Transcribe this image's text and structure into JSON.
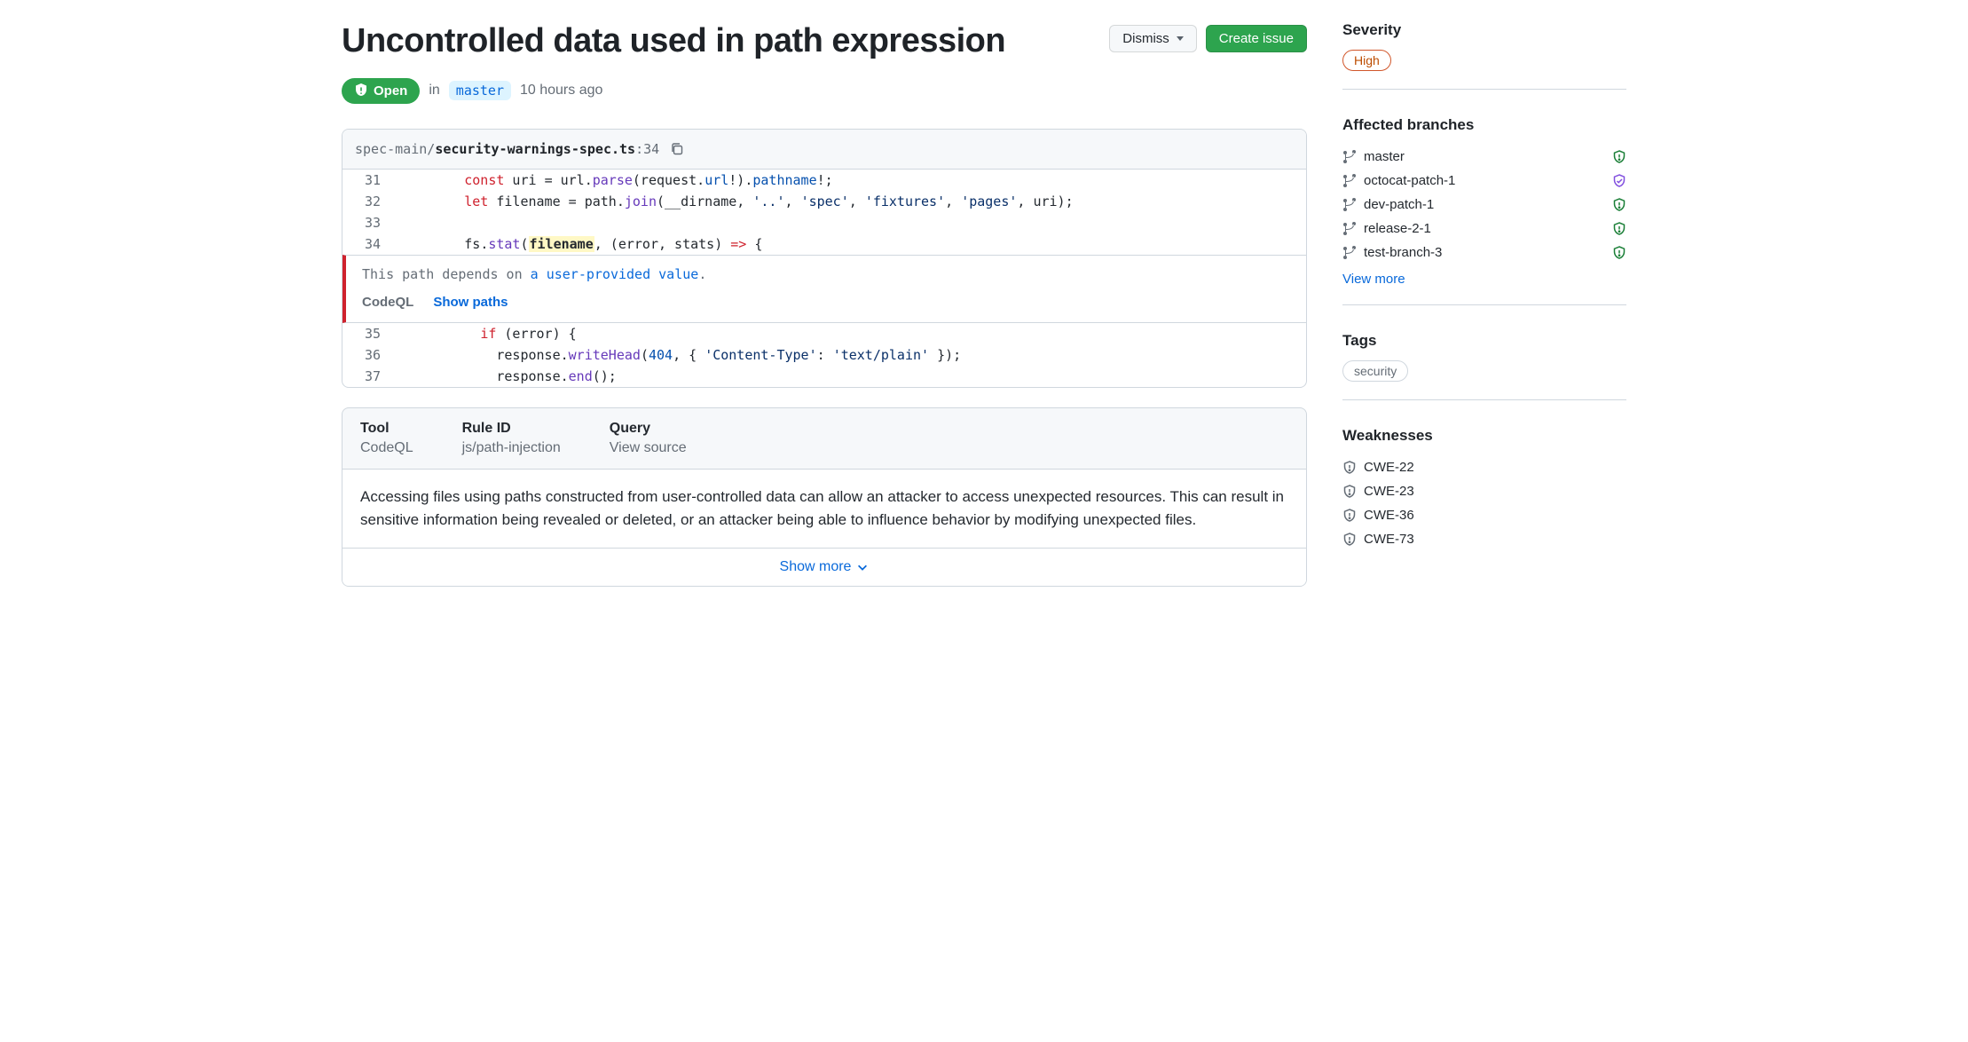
{
  "header": {
    "title": "Uncontrolled data used in path expression",
    "dismiss_label": "Dismiss",
    "create_issue_label": "Create issue"
  },
  "status": {
    "state": "Open",
    "in_word": "in",
    "branch": "master",
    "time_ago": "10 hours ago"
  },
  "code": {
    "path_prefix": "spec-main/",
    "path_file": "security-warnings-spec.ts",
    "path_line": ":34",
    "lines": {
      "31": {
        "indent": "        ",
        "tokens": [
          {
            "c": "tok-kw",
            "t": "const"
          },
          {
            "t": " uri "
          },
          {
            "c": "tok-var",
            "t": "="
          },
          {
            "t": " url"
          },
          {
            "c": "tok-var",
            "t": "."
          },
          {
            "c": "tok-fn",
            "t": "parse"
          },
          {
            "t": "(request"
          },
          {
            "c": "tok-var",
            "t": "."
          },
          {
            "c": "tok-prop",
            "t": "url"
          },
          {
            "t": "!)"
          },
          {
            "c": "tok-var",
            "t": "."
          },
          {
            "c": "tok-prop",
            "t": "pathname"
          },
          {
            "t": "!;"
          }
        ]
      },
      "32": {
        "indent": "        ",
        "tokens": [
          {
            "c": "tok-kw",
            "t": "let"
          },
          {
            "t": " filename "
          },
          {
            "c": "tok-var",
            "t": "="
          },
          {
            "t": " path"
          },
          {
            "c": "tok-var",
            "t": "."
          },
          {
            "c": "tok-fn",
            "t": "join"
          },
          {
            "t": "(__dirname, "
          },
          {
            "c": "tok-str",
            "t": "'..'"
          },
          {
            "t": ", "
          },
          {
            "c": "tok-str",
            "t": "'spec'"
          },
          {
            "t": ", "
          },
          {
            "c": "tok-str",
            "t": "'fixtures'"
          },
          {
            "t": ", "
          },
          {
            "c": "tok-str",
            "t": "'pages'"
          },
          {
            "t": ", uri);"
          }
        ]
      },
      "33": {
        "indent": "",
        "tokens": []
      },
      "34": {
        "indent": "        ",
        "tokens": [
          {
            "t": "fs"
          },
          {
            "c": "tok-var",
            "t": "."
          },
          {
            "c": "tok-fn",
            "t": "stat"
          },
          {
            "t": "("
          },
          {
            "c": "hl",
            "t": "filename"
          },
          {
            "t": ", (error, stats) "
          },
          {
            "c": "tok-kw",
            "t": "=>"
          },
          {
            "t": " {"
          }
        ]
      },
      "35": {
        "indent": "          ",
        "tokens": [
          {
            "c": "tok-kw",
            "t": "if"
          },
          {
            "t": " (error) {"
          }
        ]
      },
      "36": {
        "indent": "            ",
        "tokens": [
          {
            "t": "response"
          },
          {
            "c": "tok-var",
            "t": "."
          },
          {
            "c": "tok-fn",
            "t": "writeHead"
          },
          {
            "t": "("
          },
          {
            "c": "tok-num",
            "t": "404"
          },
          {
            "t": ", { "
          },
          {
            "c": "tok-str",
            "t": "'Content-Type'"
          },
          {
            "t": ": "
          },
          {
            "c": "tok-str",
            "t": "'text/plain'"
          },
          {
            "t": " });"
          }
        ]
      },
      "37": {
        "indent": "            ",
        "tokens": [
          {
            "t": "response"
          },
          {
            "c": "tok-var",
            "t": "."
          },
          {
            "c": "tok-fn",
            "t": "end"
          },
          {
            "t": "();"
          }
        ]
      }
    },
    "annotation": {
      "msg_prefix": "This path depends on ",
      "msg_link": "a user-provided value",
      "msg_suffix": ".",
      "tool": "CodeQL",
      "show_paths": "Show paths"
    }
  },
  "info": {
    "tool_label": "Tool",
    "tool_value": "CodeQL",
    "rule_label": "Rule ID",
    "rule_value": "js/path-injection",
    "query_label": "Query",
    "query_value": "View source",
    "description": "Accessing files using paths constructed from user-controlled data can allow an attacker to access unexpected resources. This can result in sensitive information being revealed or deleted, or an attacker being able to influence behavior by modifying unexpected files.",
    "show_more": "Show more"
  },
  "sidebar": {
    "severity_label": "Severity",
    "severity_value": "High",
    "affected_label": "Affected branches",
    "branches": [
      {
        "name": "master",
        "status": "alert"
      },
      {
        "name": "octocat-patch-1",
        "status": "verified"
      },
      {
        "name": "dev-patch-1",
        "status": "alert"
      },
      {
        "name": "release-2-1",
        "status": "alert"
      },
      {
        "name": "test-branch-3",
        "status": "alert"
      }
    ],
    "view_more": "View more",
    "tags_label": "Tags",
    "tags": [
      "security"
    ],
    "weaknesses_label": "Weaknesses",
    "weaknesses": [
      "CWE-22",
      "CWE-23",
      "CWE-36",
      "CWE-73"
    ]
  }
}
